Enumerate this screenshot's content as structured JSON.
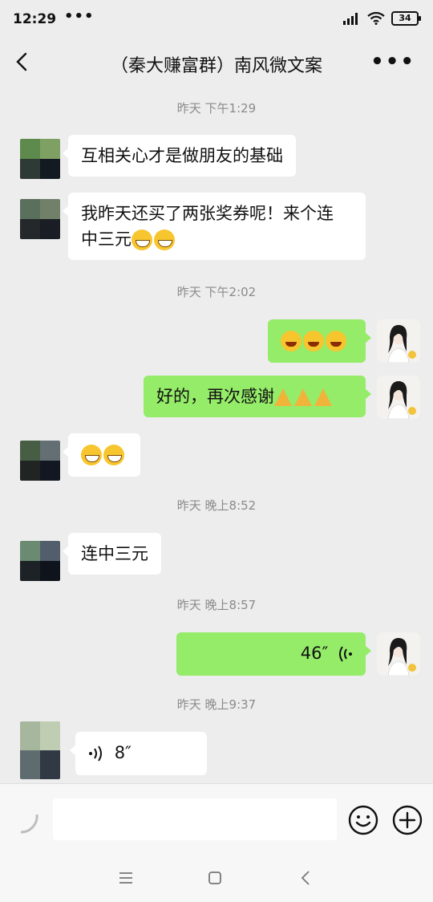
{
  "status": {
    "time": "12:29",
    "dots": "•••",
    "battery": "34"
  },
  "header": {
    "title": "（秦大赚富群）南风微文案",
    "more": "•••"
  },
  "messages": {
    "ts1": "昨天 下午1:29",
    "m1": "互相关心才是做朋友的基础",
    "m2_line1": "我昨天还买了两张奖券呢！来个连",
    "m2_line2": "中三元",
    "ts2": "昨天 下午2:02",
    "m4": "好的，再次感谢",
    "ts3": "昨天 晚上8:52",
    "m6": "连中三元",
    "ts4": "昨天 晚上8:57",
    "m7_duration": "46″",
    "ts5": "昨天 晚上9:37",
    "m8_duration": "8″"
  },
  "icons": {
    "back": "chevron-left-icon",
    "emoji": "smiley-icon",
    "plus": "plus-icon",
    "voice": "voice-wave-icon",
    "menu": "menu-icon",
    "home": "home-icon",
    "nav_back": "nav-back-icon"
  },
  "colors": {
    "bg": "#ededed",
    "bubble_out": "#95ec69",
    "bubble_in": "#ffffff",
    "timestamp": "#8a8a8a"
  }
}
